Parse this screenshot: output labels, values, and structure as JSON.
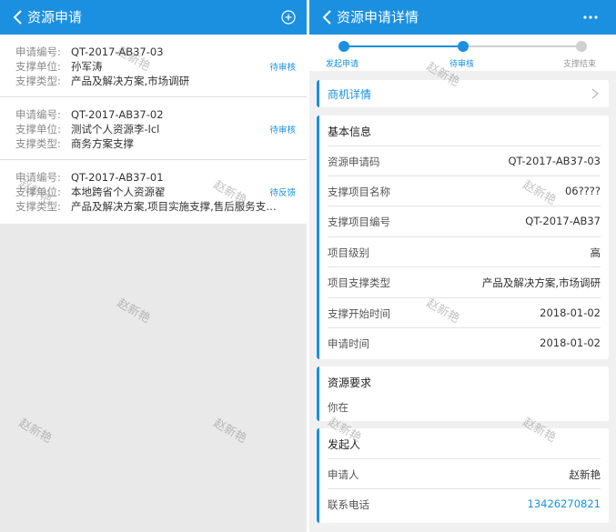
{
  "left": {
    "title": "资源申请",
    "items": [
      {
        "rows": [
          {
            "label": "申请编号:",
            "value": "QT-2017-AB37-03"
          },
          {
            "label": "支撑单位:",
            "value": "孙军涛"
          },
          {
            "label": "支撑类型:",
            "value": "产品及解决方案,市场调研"
          }
        ],
        "status": "待审核"
      },
      {
        "rows": [
          {
            "label": "申请编号:",
            "value": "QT-2017-AB37-02"
          },
          {
            "label": "支撑单位:",
            "value": "测试个人资源李-lcl"
          },
          {
            "label": "支撑类型:",
            "value": "商务方案支撑"
          }
        ],
        "status": "待审核"
      },
      {
        "rows": [
          {
            "label": "申请编号:",
            "value": "QT-2017-AB37-01"
          },
          {
            "label": "支撑单位:",
            "value": "本地跨省个人资源翟"
          },
          {
            "label": "支撑类型:",
            "value": "产品及解决方案,项目实施支撑,售后服务支…"
          }
        ],
        "status": "待反馈"
      }
    ]
  },
  "right": {
    "title": "资源申请详情",
    "steps": [
      "发起申请",
      "待审核",
      "支撑结束"
    ],
    "biz_link": "商机详情",
    "basic": {
      "heading": "基本信息",
      "fields": [
        {
          "label": "资源申请码",
          "value": "QT-2017-AB37-03"
        },
        {
          "label": "支撑项目名称",
          "value": "06????"
        },
        {
          "label": "支撑项目编号",
          "value": "QT-2017-AB37"
        },
        {
          "label": "项目级别",
          "value": "高"
        },
        {
          "label": "项目支撑类型",
          "value": "产品及解决方案,市场调研"
        },
        {
          "label": "支撑开始时间",
          "value": "2018-01-02"
        },
        {
          "label": "申请时间",
          "value": "2018-01-02"
        }
      ]
    },
    "requirement": {
      "heading": "资源要求",
      "text": "你在"
    },
    "initiator": {
      "heading": "发起人",
      "fields": [
        {
          "label": "申请人",
          "value": "赵新艳"
        },
        {
          "label": "联系电话",
          "value": "13426270821"
        }
      ]
    }
  },
  "watermark": "赵新艳",
  "colors": {
    "primary": "#1b8fe0",
    "pending_step": "#cfcfcf"
  },
  "icons": {
    "back": "chevron-left-icon",
    "add": "plus-circle-icon",
    "more": "more-icon",
    "chevron": "chevron-right-icon"
  }
}
